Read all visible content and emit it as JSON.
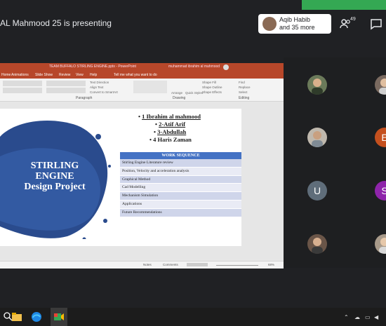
{
  "meeting": {
    "presenting_text": "AL Mahmood 25 is presenting",
    "participants_chip": {
      "name": "Aqib Habib",
      "more": "and 35 more"
    },
    "people_count": "49"
  },
  "ppt": {
    "title": "TEAM BUFFALO STIRLING ENGINE.pptx - PowerPoint",
    "user": "muhammad ibrahim al mahmood",
    "tabs": [
      "Home",
      "Animations",
      "Slide Show",
      "Review",
      "View",
      "Help",
      "Tell me what you want to do"
    ],
    "ribbon_groups": [
      "Paragraph",
      "Drawing",
      "Editing"
    ],
    "ribbon_items": [
      "Text Direction",
      "Align Text",
      "Convert to SmartArt",
      "Arrange",
      "Quick Styles",
      "Shape Fill",
      "Shape Outline",
      "Shape Effects",
      "Find",
      "Replace",
      "Select"
    ],
    "status": {
      "notes": "Notes",
      "comments": "Comments",
      "zoom": "68%"
    }
  },
  "slide": {
    "title_lines": [
      "STIRLING",
      "ENGINE",
      "Design Project"
    ],
    "names": [
      "1 Ibrahim al mahmood",
      "2-Atif Arif",
      "3-Abdullah",
      "4 Haris Zaman"
    ],
    "work_sequence": {
      "header": "WORK SEQUENCE",
      "rows": [
        "Stirling Engine Literature review",
        "Position, Velocity and acceleration analysis",
        "Graphical Method",
        "Cad Modelling",
        "Mechanism Simulation",
        "Applications",
        "Future Recommendations"
      ]
    }
  },
  "tiles": [
    {
      "letter": "",
      "color": "#6b7a5a"
    },
    {
      "letter": "",
      "color": "#7a6a60"
    },
    {
      "letter": "",
      "color": "#bfb8ad"
    },
    {
      "letter": "E",
      "color": "#c5501e"
    },
    {
      "letter": "U",
      "color": "#5f6d7a"
    },
    {
      "letter": "S",
      "color": "#8e24aa"
    },
    {
      "letter": "",
      "color": "#6a5548"
    },
    {
      "letter": "",
      "color": "#a89a8a"
    }
  ]
}
